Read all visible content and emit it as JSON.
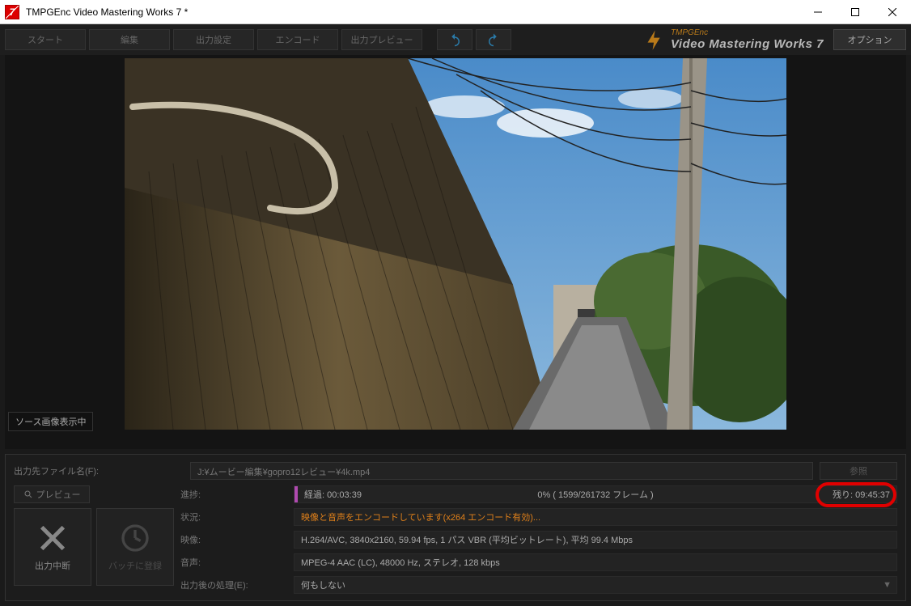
{
  "titlebar": {
    "title": "TMPGEnc Video Mastering Works 7 *"
  },
  "toolbar": {
    "start": "スタート",
    "edit": "編集",
    "output": "出力設定",
    "encode": "エンコード",
    "outprev": "出力プレビュー",
    "option": "オプション"
  },
  "brand": {
    "top": "TMPGEnc",
    "bottom": "Video Mastering Works 7"
  },
  "src_badge": "ソース画像表示中",
  "output_file": {
    "label": "出力先ファイル名(F):",
    "value": "J:¥ムービー編集¥gopro12レビュー¥4k.mp4",
    "browse": "参照"
  },
  "preview_btn": "プレビュー",
  "big_buttons": {
    "cancel": "出力中断",
    "batch": "バッチに登録"
  },
  "progress": {
    "label": "進捗:",
    "elapsed": "経過: 00:03:39",
    "pct": "0% ( 1599/261732 フレーム )",
    "remain": "残り: 09:45:37"
  },
  "status": {
    "label": "状況:",
    "value": "映像と音声をエンコードしています(x264 エンコード有効)..."
  },
  "video": {
    "label": "映像:",
    "value": "H.264/AVC, 3840x2160, 59.94 fps, 1 パス VBR (平均ビットレート), 平均 99.4 Mbps"
  },
  "audio": {
    "label": "音声:",
    "value": "MPEG-4 AAC (LC), 48000 Hz, ステレオ, 128 kbps"
  },
  "post": {
    "label": "出力後の処理(E):",
    "value": "何もしない"
  }
}
